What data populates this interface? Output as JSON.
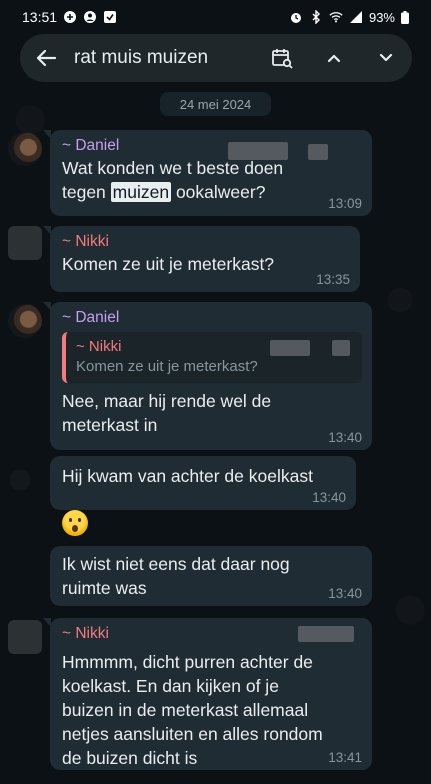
{
  "status_bar": {
    "time": "13:51",
    "battery": "93%"
  },
  "search": {
    "query": "rat muis muizen"
  },
  "date_separator": "24 mei 2024",
  "messages": [
    {
      "sender": "~ Daniel",
      "text_before": "Wat konden we t beste doen tegen ",
      "highlight": "muizen",
      "text_after": " ookalweer?",
      "time": "13:09"
    },
    {
      "sender": "~ Nikki",
      "text": "Komen ze uit je meterkast?",
      "time": "13:35"
    },
    {
      "sender": "~ Daniel",
      "quote_sender": "~ Nikki",
      "quote_text": "Komen ze uit je meterkast?",
      "text": "Nee, maar hij rende wel de meterkast in",
      "time": "13:40"
    },
    {
      "text": "Hij kwam van achter de koelkast",
      "time": "13:40"
    },
    {
      "emoji": "astonished-face-emoji"
    },
    {
      "text": "Ik wist niet eens dat daar nog ruimte was",
      "time": "13:40"
    },
    {
      "sender": "~ Nikki",
      "text": "Hmmmm, dicht purren achter de koelkast. En dan kijken of je buizen in de meterkast allemaal netjes aansluiten en alles rondom de buizen dicht is",
      "time": "13:41"
    }
  ]
}
